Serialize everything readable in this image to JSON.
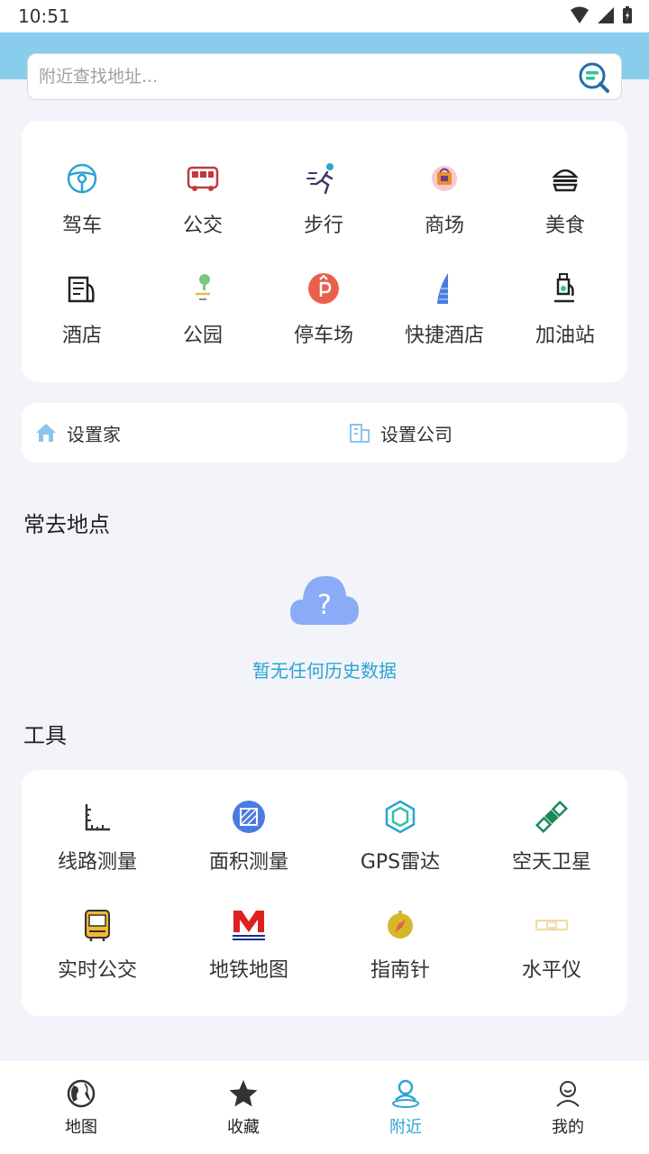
{
  "status_bar": {
    "time": "10:51"
  },
  "search": {
    "placeholder": "附近查找地址..."
  },
  "categories": [
    {
      "label": "驾车",
      "icon": "steering-wheel-icon"
    },
    {
      "label": "公交",
      "icon": "bus-icon"
    },
    {
      "label": "步行",
      "icon": "walking-icon"
    },
    {
      "label": "商场",
      "icon": "shopping-icon"
    },
    {
      "label": "美食",
      "icon": "burger-icon"
    },
    {
      "label": "酒店",
      "icon": "hotel-icon"
    },
    {
      "label": "公园",
      "icon": "park-icon"
    },
    {
      "label": "停车场",
      "icon": "parking-icon"
    },
    {
      "label": "快捷酒店",
      "icon": "tower-hotel-icon"
    },
    {
      "label": "加油站",
      "icon": "gas-station-icon"
    }
  ],
  "places": {
    "home_label": "设置家",
    "company_label": "设置公司"
  },
  "frequent": {
    "title": "常去地点",
    "empty_text": "暂无任何历史数据"
  },
  "tools": {
    "title": "工具",
    "items": [
      {
        "label": "线路测量",
        "icon": "ruler-icon"
      },
      {
        "label": "面积测量",
        "icon": "area-measure-icon"
      },
      {
        "label": "GPS雷达",
        "icon": "gps-radar-icon"
      },
      {
        "label": "空天卫星",
        "icon": "satellite-icon"
      },
      {
        "label": "实时公交",
        "icon": "realtime-bus-icon"
      },
      {
        "label": "地铁地图",
        "icon": "metro-icon"
      },
      {
        "label": "指南针",
        "icon": "compass-icon"
      },
      {
        "label": "水平仪",
        "icon": "level-icon"
      }
    ]
  },
  "nav": {
    "active_color": "#2ba4d2",
    "items": [
      {
        "label": "地图",
        "icon": "globe-icon"
      },
      {
        "label": "收藏",
        "icon": "star-icon"
      },
      {
        "label": "附近",
        "icon": "nearby-icon"
      },
      {
        "label": "我的",
        "icon": "profile-icon"
      }
    ]
  }
}
